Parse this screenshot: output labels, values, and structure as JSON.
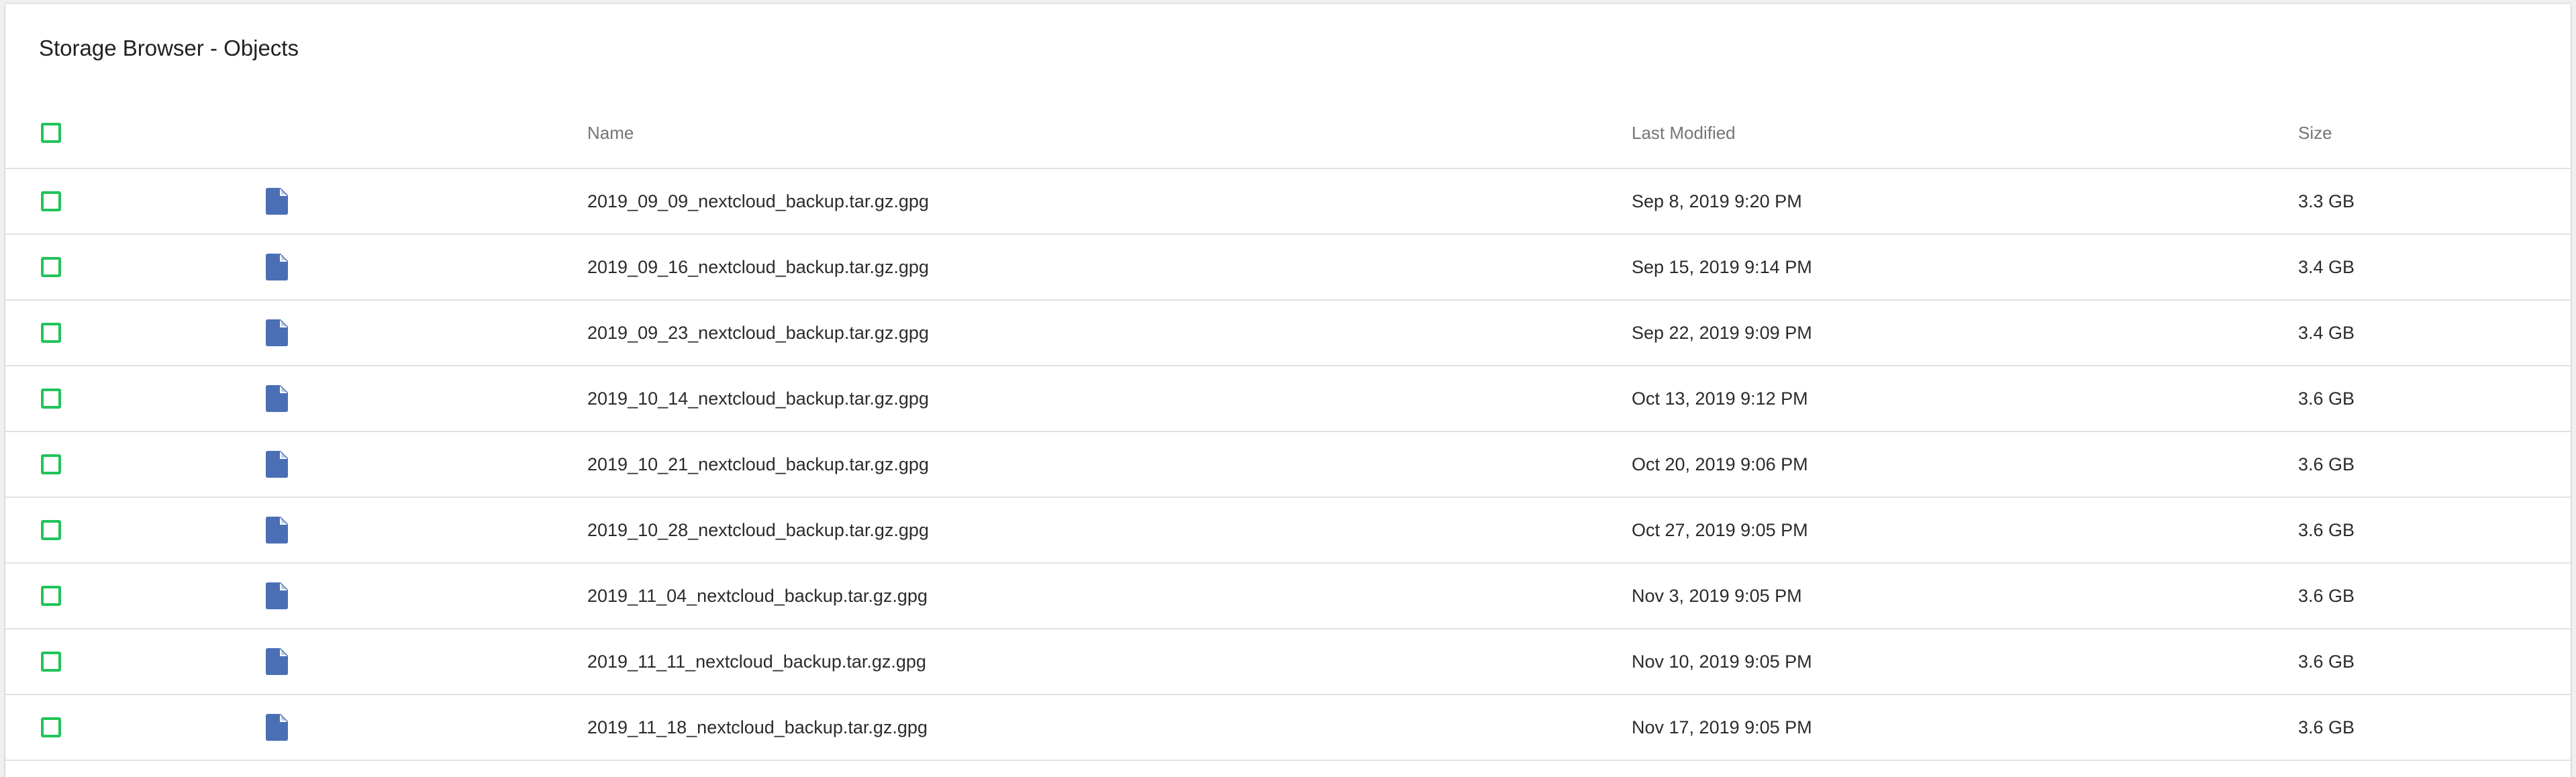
{
  "title": "Storage Browser - Objects",
  "columns": {
    "name": "Name",
    "last_modified": "Last Modified",
    "size": "Size"
  },
  "colors": {
    "checkbox": "#21c45a",
    "file_icon": "#4a6fb5"
  },
  "rows": [
    {
      "icon": "file-icon",
      "name": "2019_09_09_nextcloud_backup.tar.gz.gpg",
      "modified": "Sep 8, 2019 9:20 PM",
      "size": "3.3 GB"
    },
    {
      "icon": "file-icon",
      "name": "2019_09_16_nextcloud_backup.tar.gz.gpg",
      "modified": "Sep 15, 2019 9:14 PM",
      "size": "3.4 GB"
    },
    {
      "icon": "file-icon",
      "name": "2019_09_23_nextcloud_backup.tar.gz.gpg",
      "modified": "Sep 22, 2019 9:09 PM",
      "size": "3.4 GB"
    },
    {
      "icon": "file-icon",
      "name": "2019_10_14_nextcloud_backup.tar.gz.gpg",
      "modified": "Oct 13, 2019 9:12 PM",
      "size": "3.6 GB"
    },
    {
      "icon": "file-icon",
      "name": "2019_10_21_nextcloud_backup.tar.gz.gpg",
      "modified": "Oct 20, 2019 9:06 PM",
      "size": "3.6 GB"
    },
    {
      "icon": "file-icon",
      "name": "2019_10_28_nextcloud_backup.tar.gz.gpg",
      "modified": "Oct 27, 2019 9:05 PM",
      "size": "3.6 GB"
    },
    {
      "icon": "file-icon",
      "name": "2019_11_04_nextcloud_backup.tar.gz.gpg",
      "modified": "Nov 3, 2019 9:05 PM",
      "size": "3.6 GB"
    },
    {
      "icon": "file-icon",
      "name": "2019_11_11_nextcloud_backup.tar.gz.gpg",
      "modified": "Nov 10, 2019 9:05 PM",
      "size": "3.6 GB"
    },
    {
      "icon": "file-icon",
      "name": "2019_11_18_nextcloud_backup.tar.gz.gpg",
      "modified": "Nov 17, 2019 9:05 PM",
      "size": "3.6 GB"
    }
  ]
}
